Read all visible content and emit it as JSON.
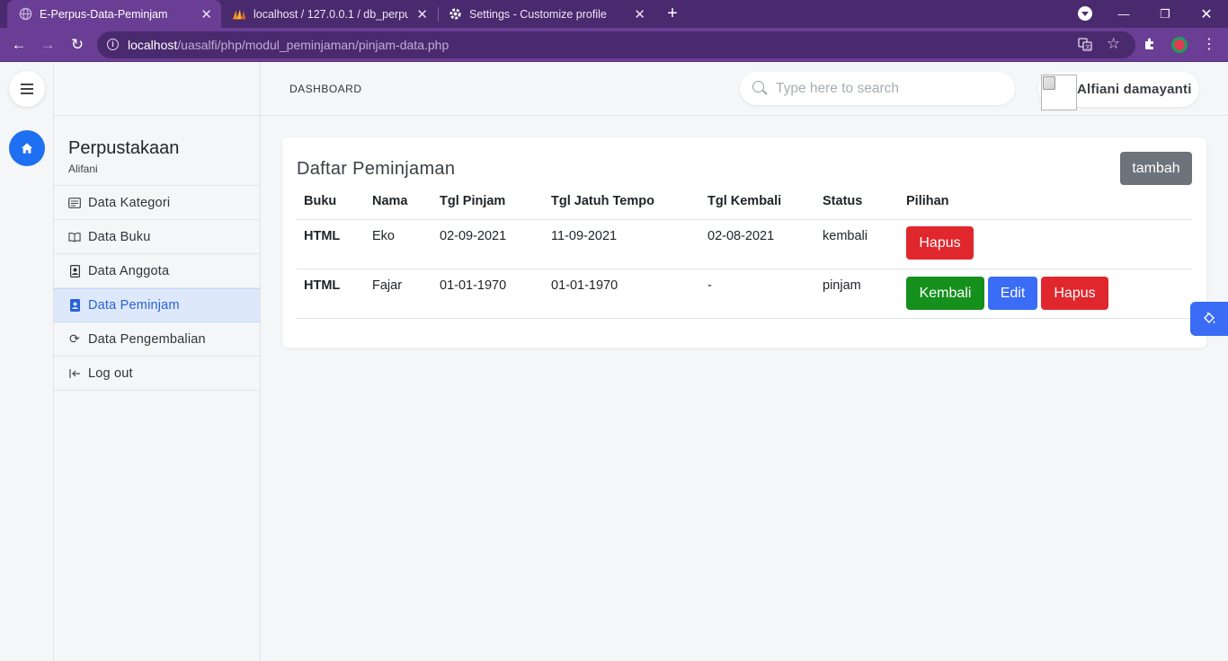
{
  "browser": {
    "tabs": [
      {
        "title": "E-Perpus-Data-Peminjam",
        "active": true,
        "icon": "globe-icon"
      },
      {
        "title": "localhost / 127.0.0.1 / db_perpus",
        "active": false,
        "icon": "phpmyadmin-icon"
      },
      {
        "title": "Settings - Customize profile",
        "active": false,
        "icon": "gear-icon"
      }
    ],
    "url_host": "localhost",
    "url_path": "/uasalfi/php/modul_peminjaman/pinjam-data.php",
    "theme_color": "#6a3e94"
  },
  "sidebar": {
    "brand": "Perpustakaan",
    "subtitle": "Alifani",
    "items": [
      {
        "label": "Data Kategori",
        "icon": "list-icon",
        "active": false
      },
      {
        "label": "Data Buku",
        "icon": "book-icon",
        "active": false
      },
      {
        "label": "Data Anggota",
        "icon": "member-icon",
        "active": false
      },
      {
        "label": "Data Peminjam",
        "icon": "borrower-icon",
        "active": true
      },
      {
        "label": "Data Pengembalian",
        "icon": "refresh-icon",
        "active": false
      },
      {
        "label": "Log out",
        "icon": "logout-icon",
        "active": false
      }
    ]
  },
  "header": {
    "breadcrumb": "DASHBOARD",
    "search_placeholder": "Type here to search",
    "user_name": "Alfiani damayanti"
  },
  "card": {
    "title": "Daftar Peminjaman",
    "add_button": "tambah",
    "columns": [
      "Buku",
      "Nama",
      "Tgl Pinjam",
      "Tgl Jatuh Tempo",
      "Tgl Kembali",
      "Status",
      "Pilihan"
    ],
    "rows": [
      {
        "buku": "HTML",
        "nama": "Eko",
        "tgl_pinjam": "02-09-2021",
        "tgl_jatuh_tempo": "11-09-2021",
        "tgl_kembali": "02-08-2021",
        "status": "kembali",
        "actions": [
          "Hapus"
        ]
      },
      {
        "buku": "HTML",
        "nama": "Fajar",
        "tgl_pinjam": "01-01-1970",
        "tgl_jatuh_tempo": "01-01-1970",
        "tgl_kembali": "-",
        "status": "pinjam",
        "actions": [
          "Kembali",
          "Edit",
          "Hapus"
        ]
      }
    ]
  },
  "colors": {
    "primary": "#3a6cf5",
    "danger": "#e0272e",
    "success": "#15901c",
    "secondary": "#6c737b"
  }
}
